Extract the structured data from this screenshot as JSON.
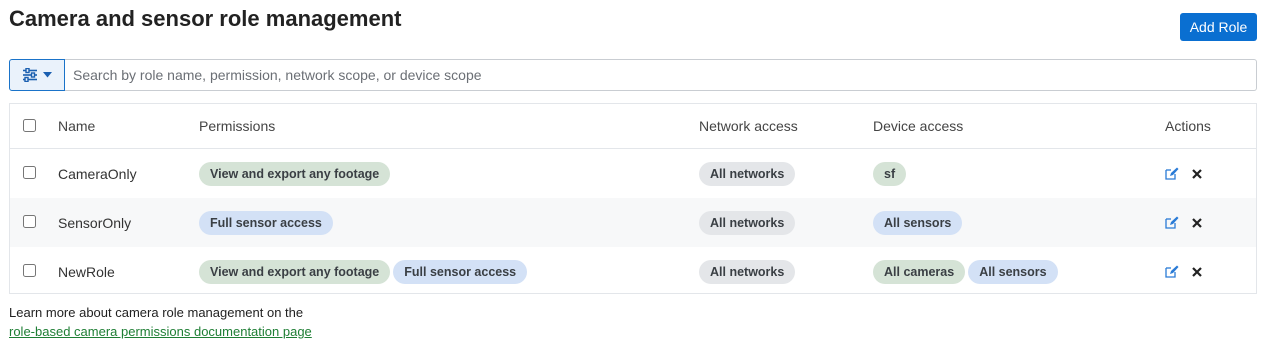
{
  "page": {
    "title": "Camera and sensor role management",
    "add_role_label": "Add Role"
  },
  "search": {
    "placeholder": "Search by role name, permission, network scope, or device scope",
    "value": "",
    "filter_icon": "sliders-icon"
  },
  "table": {
    "headers": {
      "name": "Name",
      "permissions": "Permissions",
      "network": "Network access",
      "device": "Device access",
      "actions": "Actions"
    },
    "rows": [
      {
        "name": "CameraOnly",
        "permissions": [
          "View and export any footage"
        ],
        "network": "All networks",
        "device": [
          "sf"
        ]
      },
      {
        "name": "SensorOnly",
        "permissions": [
          "Full sensor access"
        ],
        "network": "All networks",
        "device": [
          "All sensors"
        ]
      },
      {
        "name": "NewRole",
        "permissions": [
          "View and export any footage",
          "Full sensor access"
        ],
        "network": "All networks",
        "device": [
          "All cameras",
          "All sensors"
        ]
      }
    ]
  },
  "footer": {
    "text": "Learn more about camera role management on the",
    "link": "role-based camera permissions documentation page"
  },
  "colors": {
    "primary": "#0a6fd1",
    "chip_camera": "#d5e3d6",
    "chip_sensor": "#d3e1f6",
    "chip_network": "#e4e6e9",
    "link": "#1e7e34"
  }
}
